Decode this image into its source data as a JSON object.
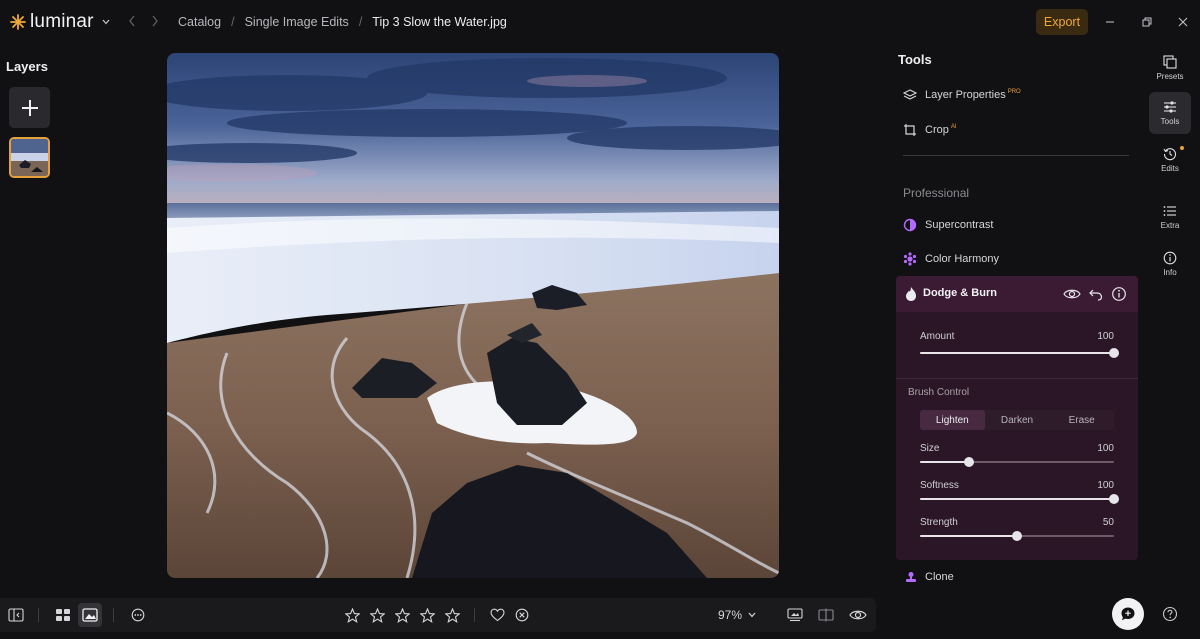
{
  "app": {
    "name": "luminar"
  },
  "breadcrumb": {
    "items": [
      "Catalog",
      "Single Image Edits",
      "Tip 3 Slow the Water.jpg"
    ]
  },
  "topbar": {
    "export_label": "Export"
  },
  "layers": {
    "title": "Layers"
  },
  "tools": {
    "title": "Tools",
    "items": [
      {
        "label": "Layer Properties",
        "badge": "PRO"
      },
      {
        "label": "Crop",
        "badge": "AI"
      }
    ],
    "section_title": "Professional",
    "professional": [
      {
        "label": "Supercontrast"
      },
      {
        "label": "Color Harmony"
      }
    ]
  },
  "dodge_burn": {
    "title": "Dodge & Burn",
    "amount_label": "Amount",
    "amount_value": "100",
    "amount_fraction": 1.0,
    "brush_title": "Brush Control",
    "modes": [
      "Lighten",
      "Darken",
      "Erase"
    ],
    "active_mode": 0,
    "sliders": [
      {
        "label": "Size",
        "value": "100",
        "fraction": 0.25
      },
      {
        "label": "Softness",
        "value": "100",
        "fraction": 1.0
      },
      {
        "label": "Strength",
        "value": "50",
        "fraction": 0.5
      }
    ]
  },
  "clone": {
    "label": "Clone"
  },
  "rail": [
    {
      "label": "Presets",
      "icon": "presets-icon"
    },
    {
      "label": "Tools",
      "icon": "tools-icon",
      "active": true
    },
    {
      "label": "Edits",
      "icon": "history-icon"
    },
    {
      "label": "Extra",
      "icon": "list-icon"
    },
    {
      "label": "Info",
      "icon": "info-icon"
    }
  ],
  "bottombar": {
    "zoom": "97%"
  },
  "colors": {
    "accent_orange": "#e7a13a",
    "accent_purple": "#b469ff",
    "dodge_panel": "#2a1626"
  }
}
